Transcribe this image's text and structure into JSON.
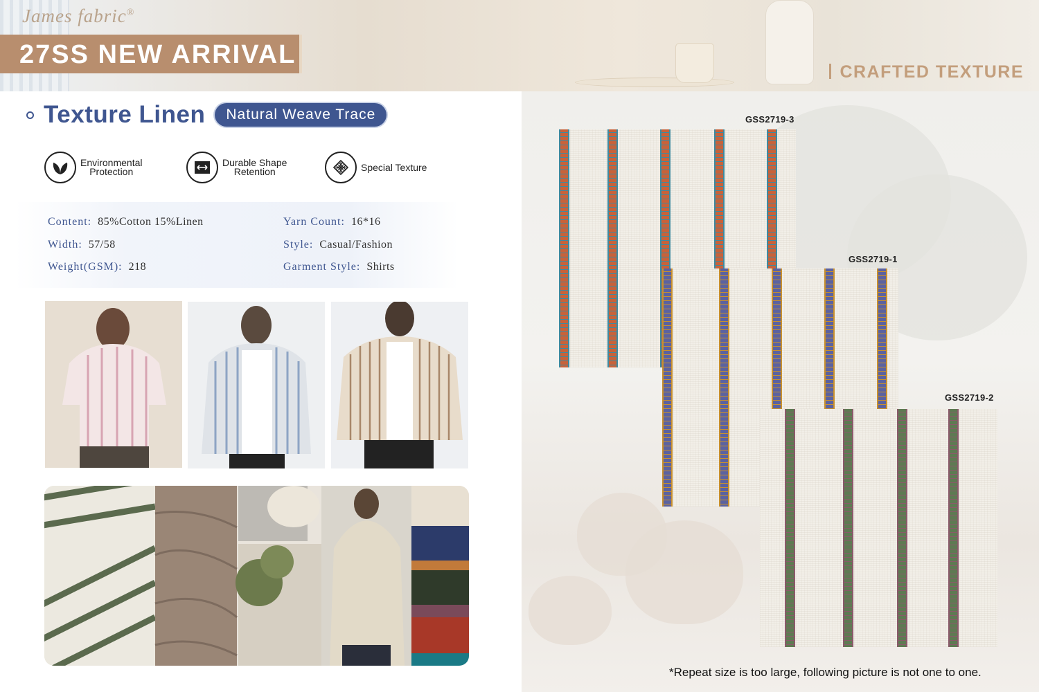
{
  "header": {
    "brand": "James fabric",
    "brand_mark": "®",
    "arrival": "27SS NEW ARRIVAL",
    "crafted": "CRAFTED TEXTURE"
  },
  "product": {
    "title": "Texture Linen",
    "tag": "Natural Weave Trace"
  },
  "features": [
    {
      "line1": "Environmental",
      "line2": "Protection",
      "icon": "leaf-icon"
    },
    {
      "line1": "Durable Shape",
      "line2": "Retention",
      "icon": "shirt-icon"
    },
    {
      "line1": "Special Texture",
      "line2": "",
      "icon": "weave-icon"
    }
  ],
  "specs": {
    "content_label": "Content:",
    "content": "85%Cotton 15%Linen",
    "yarn_label": "Yarn Count:",
    "yarn": "16*16",
    "width_label": "Width:",
    "width": "57/58",
    "style_label": "Style:",
    "style": "Casual/Fashion",
    "weight_label": "Weight(GSM):",
    "weight": "218",
    "garment_label": "Garment Style:",
    "garment": "Shirts"
  },
  "swatches": [
    {
      "code": "GSS2719-3",
      "stripe_color": "#c8623a",
      "accent": "#3e8aa0"
    },
    {
      "code": "GSS2719-1",
      "stripe_color": "#5b62a0",
      "accent": "#c8902e"
    },
    {
      "code": "GSS2719-2",
      "stripe_color": "#5e7a52",
      "accent": "#8a5a6a"
    }
  ],
  "palette": [
    "#e8e0d2",
    "#2c3b6a",
    "#c27a3a",
    "#2f3a2a",
    "#7a4a5a",
    "#a83828",
    "#1a7a86"
  ],
  "note": "*Repeat size is too large,  following picture is not one to one."
}
